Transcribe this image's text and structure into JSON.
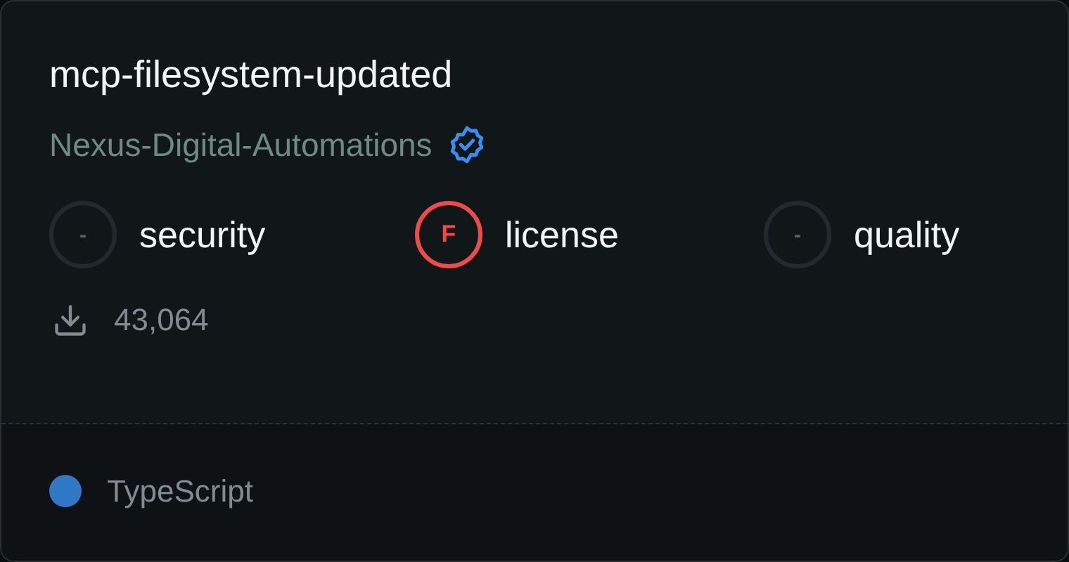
{
  "title": "mcp-filesystem-updated",
  "author": {
    "name": "Nexus-Digital-Automations",
    "verified": true
  },
  "scores": [
    {
      "kind": "none",
      "grade": "-",
      "label": "security"
    },
    {
      "kind": "graded",
      "grade": "F",
      "label": "license",
      "color": "#f04a4a"
    },
    {
      "kind": "none",
      "grade": "-",
      "label": "quality"
    }
  ],
  "downloads": "43,064",
  "language": {
    "name": "TypeScript",
    "color": "#3178c6"
  }
}
